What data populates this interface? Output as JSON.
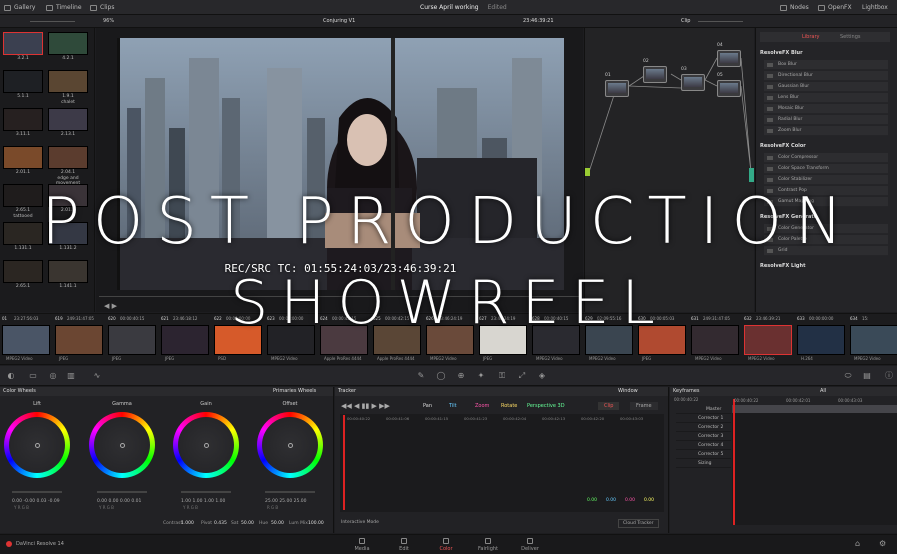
{
  "topbar": {
    "gallery": "Gallery",
    "timeline": "Timeline",
    "clips": "Clips",
    "project": "Curse April working",
    "status": "Edited",
    "nodes": "Nodes",
    "openfx": "OpenFX",
    "lightbox": "Lightbox"
  },
  "viewer": {
    "zoom": "96%",
    "clip_name": "Conjuring V1",
    "timecode": "23:46:39:21",
    "rec_src": "REC/SRC TC: 01:55:24:03/23:46:39:21"
  },
  "node_editor": {
    "mode": "Clip",
    "node_labels": [
      "01",
      "02",
      "03",
      "04",
      "05"
    ]
  },
  "library": {
    "tab_library": "Library",
    "tab_settings": "Settings",
    "sections": [
      {
        "title": "ResolveFX Blur",
        "items": [
          "Box Blur",
          "Directional Blur",
          "Gaussian Blur",
          "Lens Blur",
          "Mosaic Blur",
          "Radial Blur",
          "Zoom Blur"
        ]
      },
      {
        "title": "ResolveFX Color",
        "items": [
          "Color Compressor",
          "Color Space Transform",
          "Color Stabilizer",
          "Contrast Pop",
          "Gamut Mapping"
        ]
      },
      {
        "title": "ResolveFX Generate",
        "items": [
          "Color Generator",
          "Color Palette",
          "Grid"
        ]
      },
      {
        "title": "ResolveFX Light",
        "items": []
      }
    ]
  },
  "gallery": {
    "labels": [
      "3.2.1",
      "4.2.1",
      "5.1.1",
      "1.9.1",
      "3.11.1",
      "2.13.1",
      "2.01.1",
      "2.04.1",
      "2.65.1",
      "2.01.1",
      "1.131.1",
      "1.131.2",
      "2.65.1",
      "1.141.1"
    ],
    "sub": [
      "",
      "",
      "",
      "chalet",
      "",
      "",
      "",
      "edge and movement",
      "tattooed",
      "",
      "",
      "",
      "",
      ""
    ]
  },
  "clips": [
    {
      "n": "01",
      "tc": "23:27:56:03",
      "v": "V1",
      "label": "MPEG2 Video"
    },
    {
      "n": "619",
      "tc": "249:31:47:05",
      "v": "V1",
      "label": "JPEG"
    },
    {
      "n": "620",
      "tc": "00:00:40:15",
      "v": "V1",
      "label": "JPEG"
    },
    {
      "n": "621",
      "tc": "23:46:18:12",
      "v": "V1",
      "label": "JPEG"
    },
    {
      "n": "622",
      "tc": "00:00:00:00",
      "v": "V1",
      "label": "PSD"
    },
    {
      "n": "623",
      "tc": "00:00:00:00",
      "v": "V1",
      "label": "MPEG2 Video"
    },
    {
      "n": "624",
      "tc": "00:00:42:15",
      "v": "V1",
      "label": "Apple ProRes 4444"
    },
    {
      "n": "625",
      "tc": "00:00:42:15",
      "v": "V1",
      "label": "Apple ProRes 4444"
    },
    {
      "n": "626",
      "tc": "23:46:24:19",
      "v": "V1",
      "label": "MPEG2 Video"
    },
    {
      "n": "627",
      "tc": "23:46:24:19",
      "v": "V1",
      "label": "JPEG"
    },
    {
      "n": "628",
      "tc": "00:00:40:15",
      "v": "V1",
      "label": "MPEG2 Video"
    },
    {
      "n": "629",
      "tc": "02:09:55:16",
      "v": "V1",
      "label": "MPEG2 Video"
    },
    {
      "n": "630",
      "tc": "00:00:05:03",
      "v": "V1",
      "label": "JPEG"
    },
    {
      "n": "631",
      "tc": "249:31:47:05",
      "v": "V1",
      "label": "MPEG2 Video"
    },
    {
      "n": "632",
      "tc": "23:46:39:21",
      "v": "V1",
      "label": "MPEG2 Video"
    },
    {
      "n": "633",
      "tc": "00:00:00:00",
      "v": "V1",
      "label": "H.264"
    },
    {
      "n": "634",
      "tc": "15:",
      "v": "V1",
      "label": "MPEG2 Video"
    }
  ],
  "color_wheels": {
    "title": "Color Wheels",
    "mode": "Primaries Wheels",
    "wheels": [
      {
        "name": "Lift",
        "vals": "0.00  -0.00  0.03  -0.09",
        "sub": "Y   R   G   B"
      },
      {
        "name": "Gamma",
        "vals": "0.00  0.00  0.00  0.01",
        "sub": "Y   R   G   B"
      },
      {
        "name": "Gain",
        "vals": "1.00  1.00  1.00  1.00",
        "sub": "Y   R   G   B"
      },
      {
        "name": "Offset",
        "vals": "25.00  25.00  25.00",
        "sub": "R   G   B"
      }
    ],
    "contrast_label": "Contrast",
    "contrast": "1.000",
    "pivot_label": "Pivot",
    "pivot": "0.435",
    "sat_label": "Sat",
    "sat": "50.00",
    "hue_label": "Hue",
    "hue": "50.00",
    "lummix_label": "Lum Mix",
    "lummix": "100.00"
  },
  "tracker": {
    "title": "Tracker",
    "window": "Window",
    "toggles": [
      "Pan",
      "Tilt",
      "Zoom",
      "Rotate",
      "Perspective 3D"
    ],
    "clip": "Clip",
    "frame": "Frame",
    "times": [
      "00:00:40:22",
      "00:00:41:06",
      "00:00:41:15",
      "00:00:41:23",
      "00:00:42:04",
      "00:00:42:13",
      "00:00:42:20",
      "00:00:43:03"
    ],
    "readouts": [
      "0.00",
      "0.00",
      "0.00",
      "0.00"
    ],
    "interactive": "Interactive Mode",
    "cloud": "Cloud Tracker"
  },
  "keyframes": {
    "title": "Keyframes",
    "filter": "All",
    "times": [
      "00:00:40:22",
      "00:00:40:22",
      "00:00:42:01",
      "00:00:43:03"
    ],
    "rows": [
      "Master",
      "Corrector 1",
      "Corrector 2",
      "Corrector 3",
      "Corrector 4",
      "Corrector 5",
      "Sizing"
    ]
  },
  "pages": [
    "Media",
    "Edit",
    "Color",
    "Fairlight",
    "Deliver"
  ],
  "app_name": "DaVinci Resolve 14",
  "overlay": {
    "line1": "POST PRODUCTION",
    "line2": "SHOWREEL"
  }
}
